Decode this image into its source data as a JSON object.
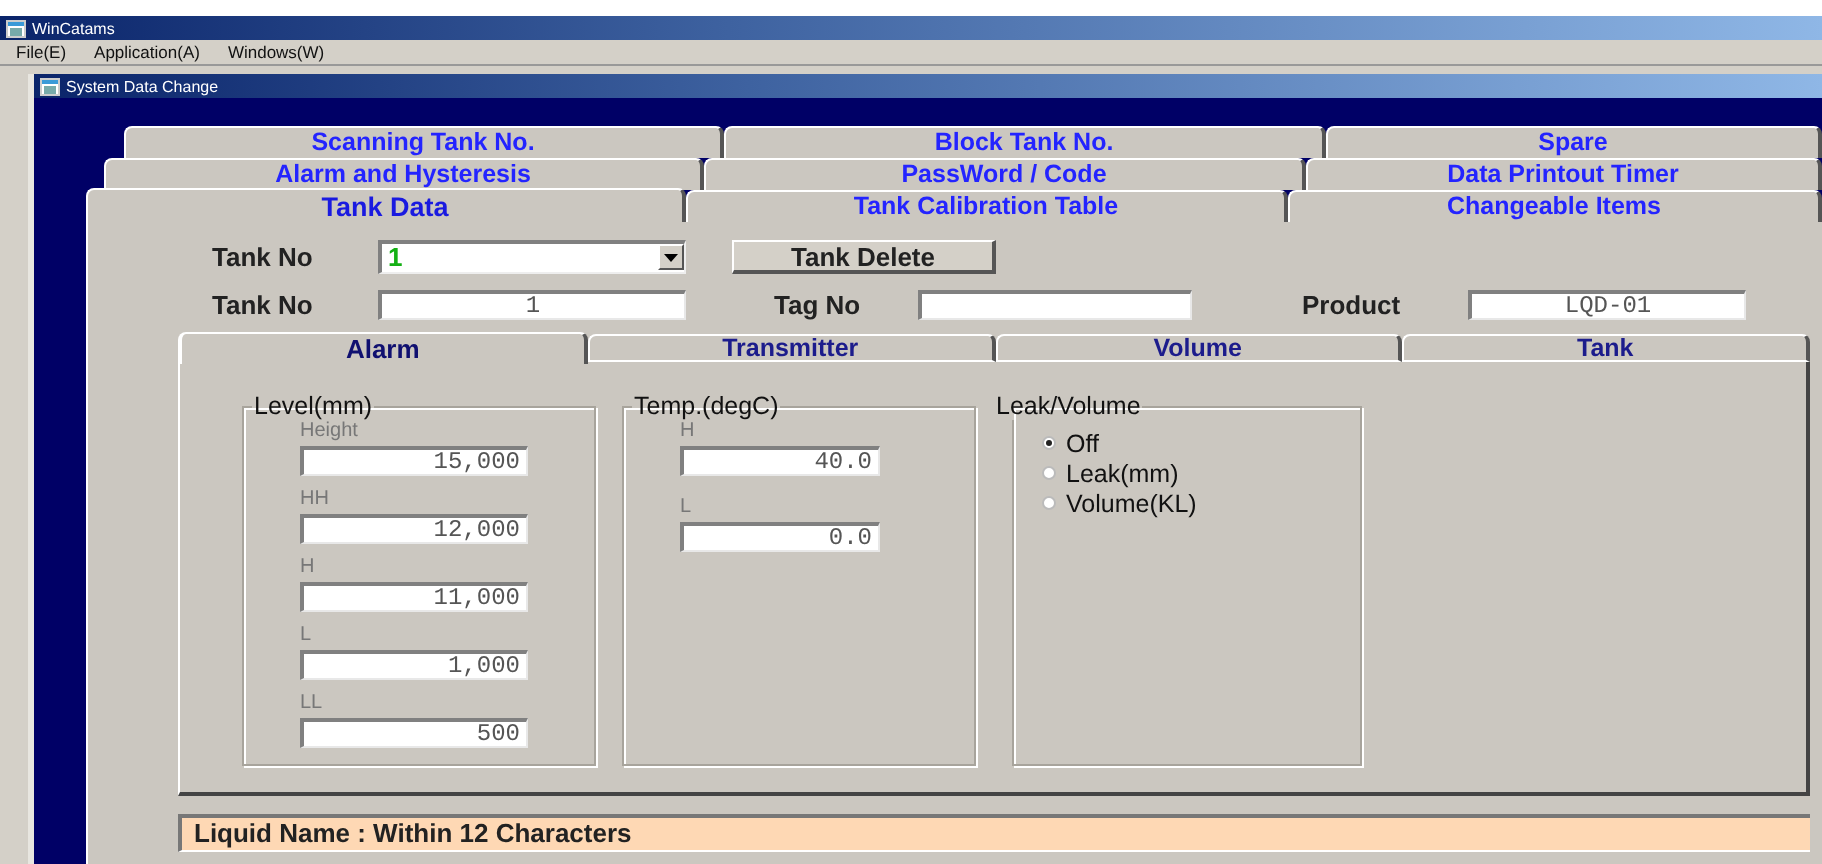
{
  "app": {
    "title": "WinCatams",
    "menu": [
      "File(E)",
      "Application(A)",
      "Windows(W)"
    ]
  },
  "child_window": {
    "title": "System Data Change"
  },
  "tab_rows": [
    {
      "tabs": [
        {
          "label": "Scanning Tank No.",
          "selected": false
        },
        {
          "label": "Block Tank No.",
          "selected": false
        },
        {
          "label": "Spare",
          "selected": false
        }
      ]
    },
    {
      "tabs": [
        {
          "label": "Alarm and Hysteresis",
          "selected": false
        },
        {
          "label": "PassWord / Code",
          "selected": false
        },
        {
          "label": "Data Printout Timer",
          "selected": false
        }
      ]
    },
    {
      "tabs": [
        {
          "label": "Tank Data",
          "selected": true
        },
        {
          "label": "Tank Calibration Table",
          "selected": false
        },
        {
          "label": "Changeable Items",
          "selected": false
        }
      ]
    }
  ],
  "tank_select": {
    "label": "Tank No",
    "value": "1"
  },
  "delete_button": "Tank Delete",
  "info_fields": [
    {
      "label": "Tank No",
      "value": "1"
    },
    {
      "label": "Tag No"
    },
    {
      "label": "Product",
      "value": "LQD-01"
    }
  ],
  "inner_tabs": [
    {
      "label": "Alarm",
      "selected": true
    },
    {
      "label": "Transmitter",
      "selected": false
    },
    {
      "label": "Volume",
      "selected": false
    },
    {
      "label": "Tank",
      "selected": false
    }
  ],
  "groups": [
    {
      "title": "Level(mm)",
      "kind": "fields",
      "fields": [
        {
          "label": "Height",
          "value": "15,000"
        },
        {
          "label": "HH",
          "value": "12,000"
        },
        {
          "label": "H",
          "value": "11,000"
        },
        {
          "label": "L",
          "value": "1,000"
        },
        {
          "label": "LL",
          "value": "500"
        }
      ]
    },
    {
      "title": "Temp.(degC)",
      "kind": "fields",
      "fields": [
        {
          "label": "H",
          "value": "40.0"
        },
        {
          "label": "L",
          "value": "0.0"
        }
      ]
    },
    {
      "title": "Leak/Volume",
      "kind": "radios",
      "options": [
        {
          "label": "Off",
          "selected": true
        },
        {
          "label": "Leak(mm)",
          "selected": false
        },
        {
          "label": "Volume(KL)",
          "selected": false
        }
      ]
    }
  ],
  "status_bar": "Liquid Name : Within 12 Characters"
}
